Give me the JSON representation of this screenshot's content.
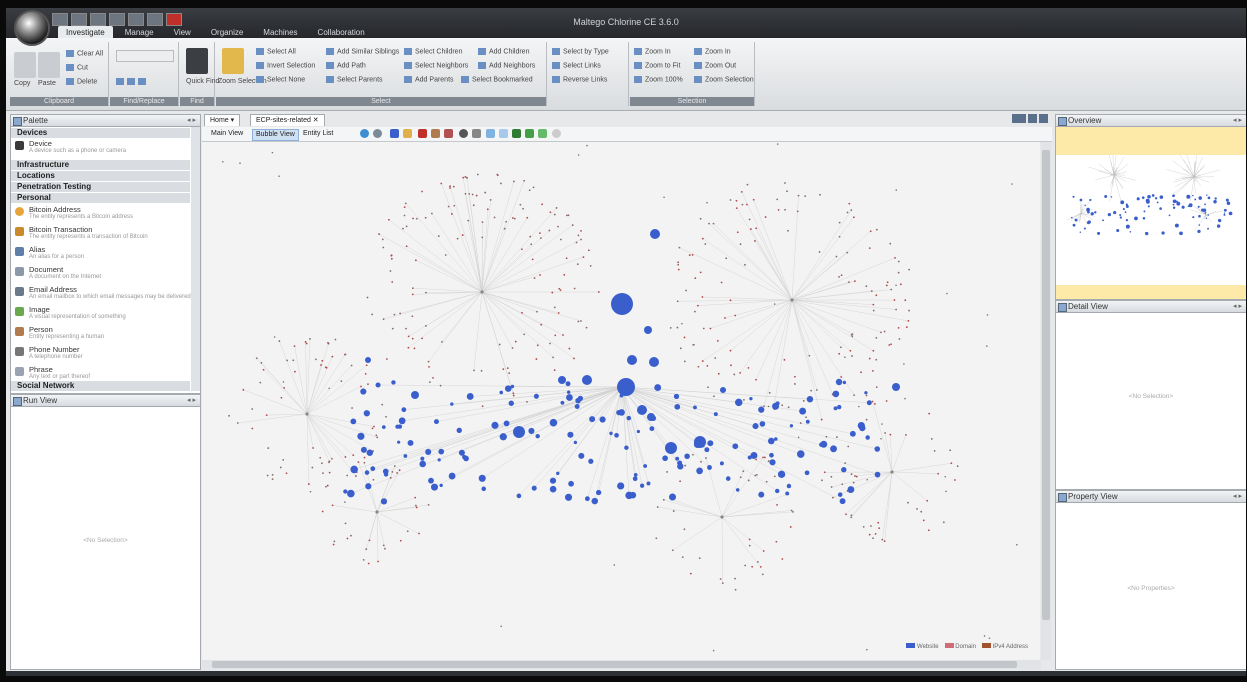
{
  "app": {
    "title": "Maltego Chlorine CE 3.6.0"
  },
  "menu_tabs": [
    "Investigate",
    "Manage",
    "View",
    "Organize",
    "Machines",
    "Collaboration"
  ],
  "ribbon": {
    "groups": [
      "Clipboard",
      "Find/Replace",
      "Find",
      "Select",
      "Selection"
    ],
    "copy": "Copy",
    "paste": "Paste",
    "clear_all": "Clear All",
    "cut": "Cut",
    "delete": "Delete",
    "quick_find": "Quick Find",
    "zoom_selection_big": "Zoom Selection",
    "select_all": "Select All",
    "invert_selection": "Invert Selection",
    "select_none": "Select None",
    "add_similar_siblings": "Add Similar Siblings",
    "add_path": "Add Path",
    "select_parents": "Select Parents",
    "select_children": "Select Children",
    "select_neighbors": "Select Neighbors",
    "add_parents": "Add Parents",
    "add_children": "Add Children",
    "add_neighbors": "Add Neighbors",
    "select_bookmarked": "Select Bookmarked",
    "select_by_type": "Select by Type",
    "select_links": "Select Links",
    "reverse_links": "Reverse Links",
    "zoom_in": "Zoom In",
    "zoom_to_fit": "Zoom to Fit",
    "zoom_100": "Zoom 100%",
    "zoom_in2": "Zoom In",
    "zoom_out": "Zoom Out",
    "zoom_selection": "Zoom Selection"
  },
  "palette": {
    "title": "Palette",
    "categories": [
      "Devices",
      "Infrastructure",
      "Locations",
      "Penetration Testing",
      "Personal",
      "Social Network"
    ],
    "entities": [
      {
        "name": "Device",
        "desc": "A device such as a phone or camera",
        "color": "#3a3a3a"
      },
      {
        "name": "Bitcoin Address",
        "desc": "The entity represents a Bitcoin address",
        "color": "#e8a33a"
      },
      {
        "name": "Bitcoin Transaction",
        "desc": "The entity represents a transaction of Bitcoin",
        "color": "#c98a2b"
      },
      {
        "name": "Alias",
        "desc": "An alias for a person",
        "color": "#5f7ea8"
      },
      {
        "name": "Document",
        "desc": "A document on the Internet",
        "color": "#8c99a8"
      },
      {
        "name": "Email Address",
        "desc": "An email mailbox to which email messages may be delivered",
        "color": "#6b7a8a"
      },
      {
        "name": "Image",
        "desc": "A visual representation of something",
        "color": "#6aa84f"
      },
      {
        "name": "Person",
        "desc": "Entity representing a human",
        "color": "#b07c4f"
      },
      {
        "name": "Phone Number",
        "desc": "A telephone number",
        "color": "#777777"
      },
      {
        "name": "Phrase",
        "desc": "Any text or part thereof",
        "color": "#99a4b0"
      }
    ]
  },
  "run_view": {
    "title": "Run View",
    "empty": "<No Selection>"
  },
  "doc_tabs": {
    "home": "Home",
    "graph": "ECP-sites-related"
  },
  "view_tabs": [
    "Main View",
    "Bubble View",
    "Entity List"
  ],
  "overview": {
    "title": "Overview"
  },
  "detail_view": {
    "title": "Detail View",
    "empty": "<No Selection>"
  },
  "property_view": {
    "title": "Property View",
    "empty": "<No Properties>"
  },
  "legend": [
    {
      "label": "Website",
      "color": "#3a5fcd"
    },
    {
      "label": "Domain",
      "color": "#d06b7a"
    },
    {
      "label": "IPv4 Address",
      "color": "#a0522d"
    }
  ],
  "colors": {
    "node_blue": "#3a5fcd",
    "node_red": "#b04a4a",
    "edge": "#cfcfcf",
    "overview_bg": "#fde9a8"
  }
}
